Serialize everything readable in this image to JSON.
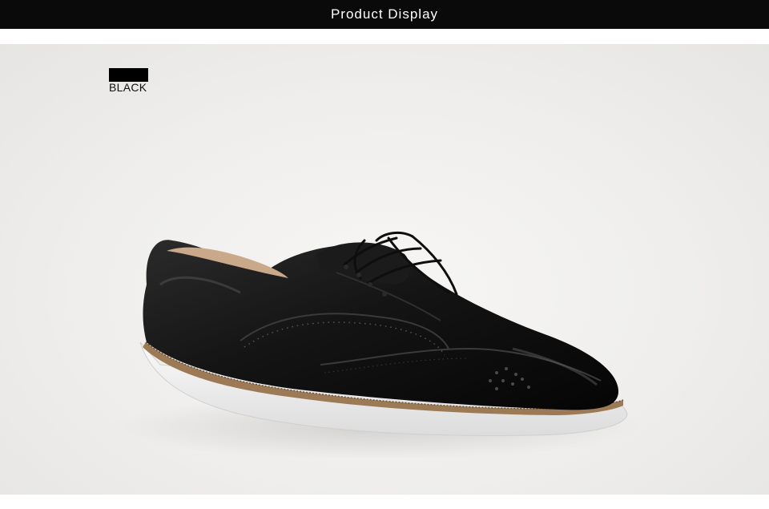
{
  "header": {
    "title": "Product Display",
    "background": "#0a0a0a",
    "text_color": "#ffffff"
  },
  "product": {
    "color_name": "BLACK",
    "swatch_color": "#000000",
    "image_subject": "shoe-photo"
  }
}
